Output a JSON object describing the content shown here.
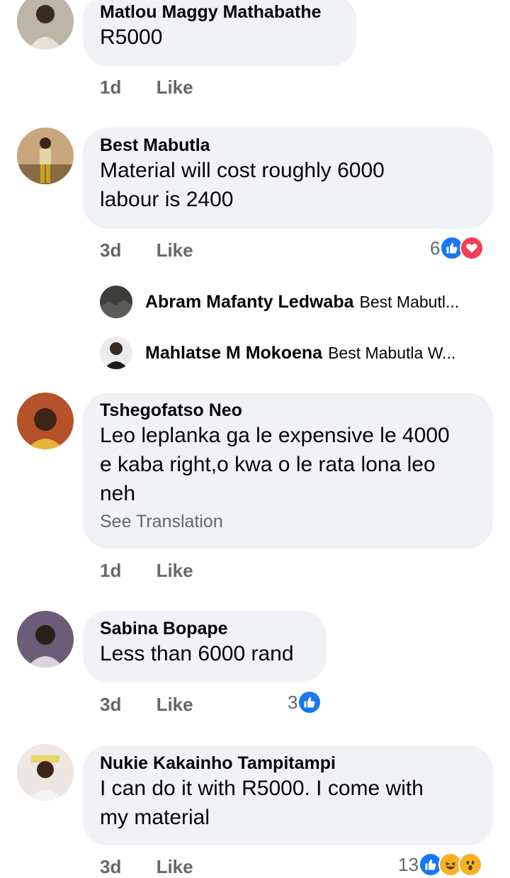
{
  "comments": [
    {
      "name": "Matlou Maggy Mathabathe",
      "lines": [
        "R5000"
      ],
      "time": "1d",
      "like": "Like"
    },
    {
      "name": "Best Mabutla",
      "lines": [
        "Material will cost roughly 6000",
        "labour is 2400"
      ],
      "time": "3d",
      "like": "Like",
      "reactions": {
        "count": "6",
        "types": [
          "like",
          "love"
        ]
      }
    },
    {
      "name": "Tshegofatso Neo",
      "lines": [
        "Leo leplanka ga le expensive le 4000",
        "e kaba right,o kwa o le rata lona leo",
        "neh"
      ],
      "see_translation": "See Translation",
      "time": "1d",
      "like": "Like"
    },
    {
      "name": "Sabina Bopape",
      "lines": [
        "Less than 6000 rand"
      ],
      "time": "3d",
      "like": "Like",
      "reactions": {
        "count": "3",
        "types": [
          "like"
        ]
      }
    },
    {
      "name": "Nukie Kakainho Tampitampi",
      "lines": [
        "I can do it with R5000. I come with",
        "my material"
      ],
      "time": "3d",
      "like": "Like",
      "reactions": {
        "count": "13",
        "types": [
          "like",
          "haha",
          "wow"
        ]
      }
    }
  ],
  "replies": [
    {
      "name": "Abram Mafanty Ledwaba",
      "preview": "Best Mabutl..."
    },
    {
      "name": "Mahlatse M Mokoena",
      "preview": "Best Mabutla W..."
    }
  ],
  "colors": {
    "bubble": "#f0f2f5",
    "meta": "#65676b",
    "like": "#1877f2",
    "love": "#f33e58",
    "haha": "#f7b125"
  }
}
